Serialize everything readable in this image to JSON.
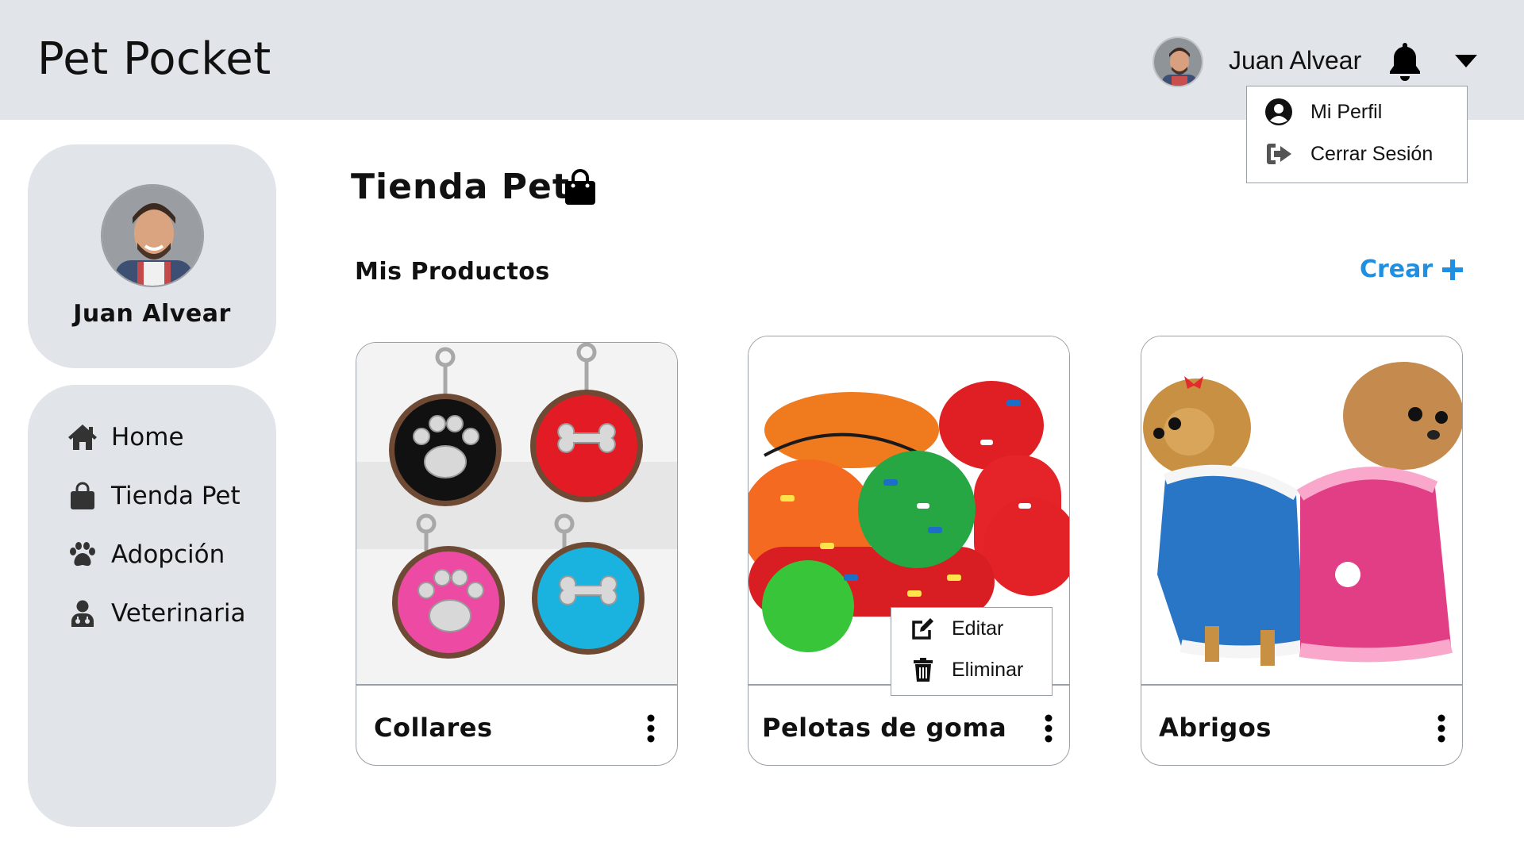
{
  "app": {
    "title": "Pet Pocket"
  },
  "user": {
    "name": "Juan Alvear"
  },
  "user_menu": {
    "items": [
      {
        "label": "Mi Perfil",
        "icon": "user-circle-icon"
      },
      {
        "label": "Cerrar Sesión",
        "icon": "sign-out-icon"
      }
    ]
  },
  "sidebar": {
    "nav": [
      {
        "label": "Home",
        "icon": "home-icon"
      },
      {
        "label": "Tienda Pet",
        "icon": "shopping-bag-icon"
      },
      {
        "label": "Adopción",
        "icon": "paw-icon"
      },
      {
        "label": "Veterinaria",
        "icon": "doctor-icon"
      }
    ]
  },
  "main": {
    "title": "Tienda Pet",
    "section_title": "Mis Productos",
    "create_label": "Crear",
    "products": [
      {
        "name": "Collares"
      },
      {
        "name": "Pelotas de goma"
      },
      {
        "name": "Abrigos"
      }
    ],
    "context_menu": {
      "edit_label": "Editar",
      "delete_label": "Eliminar"
    }
  },
  "colors": {
    "header_bg": "#e1e4e8",
    "accent": "#1e8fe1",
    "text": "#111111"
  }
}
